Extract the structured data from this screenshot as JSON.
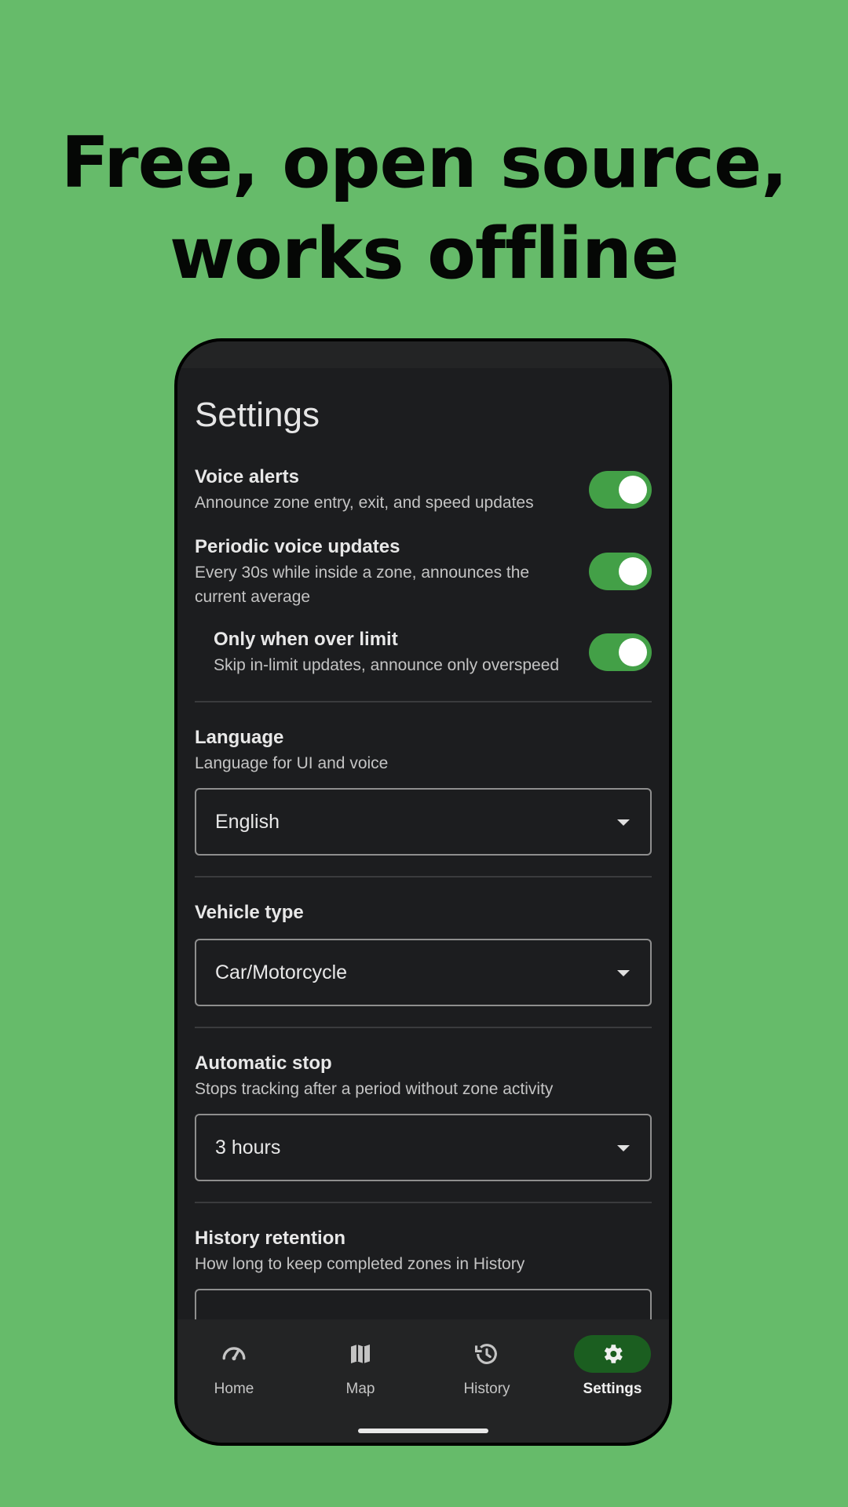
{
  "headline": {
    "line1": "Free, open source,",
    "line2": "works offline"
  },
  "screen": {
    "title": "Settings",
    "toggles": [
      {
        "title": "Voice alerts",
        "subtitle": "Announce zone entry, exit, and speed updates",
        "on": true
      },
      {
        "title": "Periodic voice updates",
        "subtitle": "Every 30s while inside a zone, announces the current average",
        "on": true
      },
      {
        "title": "Only when over limit",
        "subtitle": "Skip in-limit updates, announce only overspeed",
        "on": true
      }
    ],
    "language": {
      "title": "Language",
      "subtitle": "Language for UI and voice",
      "value": "English"
    },
    "vehicle": {
      "title": "Vehicle type",
      "value": "Car/Motorcycle"
    },
    "auto_stop": {
      "title": "Automatic stop",
      "subtitle": "Stops tracking after a period without zone activity",
      "value": "3 hours"
    },
    "history_retention": {
      "title": "History retention",
      "subtitle": "How long to keep completed zones in History"
    }
  },
  "nav": {
    "items": [
      {
        "label": "Home",
        "icon": "speedometer-icon"
      },
      {
        "label": "Map",
        "icon": "map-icon"
      },
      {
        "label": "History",
        "icon": "history-icon"
      },
      {
        "label": "Settings",
        "icon": "gear-icon"
      }
    ],
    "active": "Settings"
  },
  "colors": {
    "background": "#66bb6a",
    "accent": "#43a047",
    "active_nav": "#1b5e20",
    "surface": "#1c1d1f"
  }
}
